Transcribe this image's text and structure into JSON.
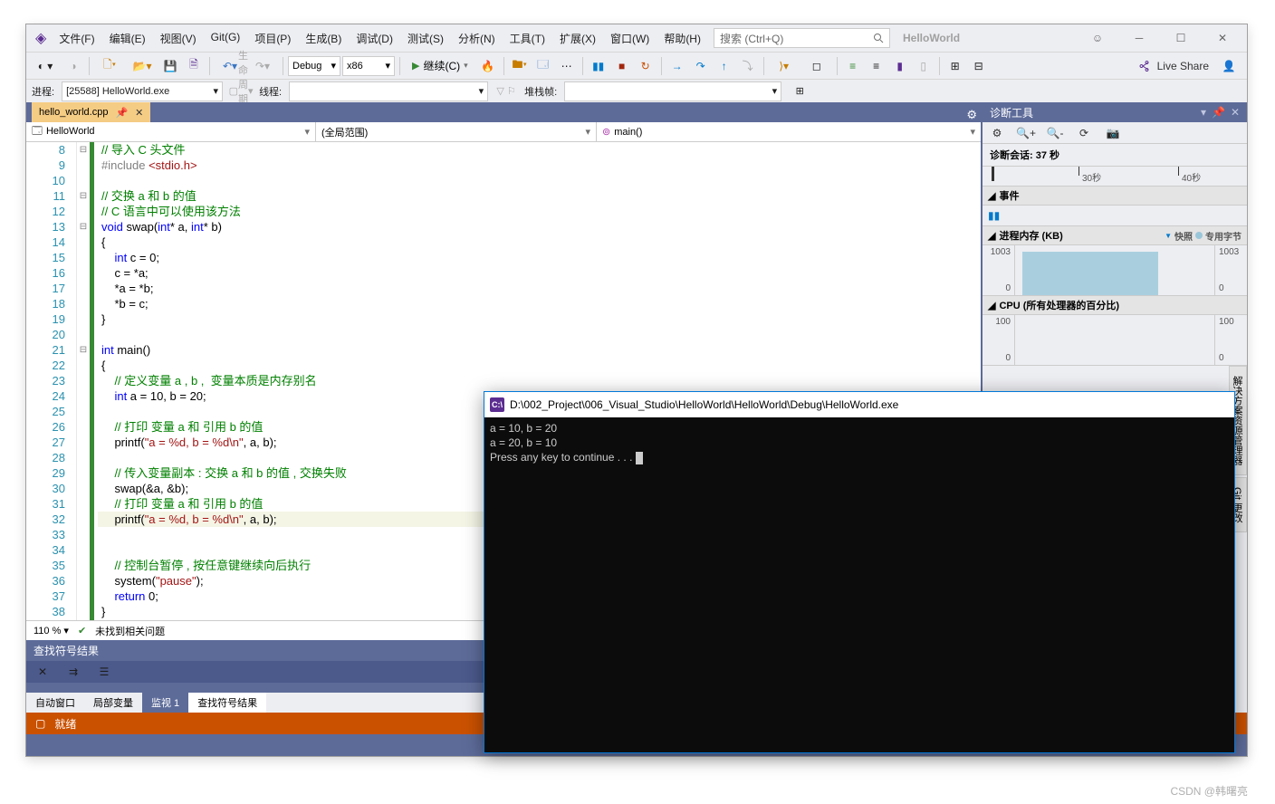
{
  "menu": {
    "file": "文件(F)",
    "edit": "编辑(E)",
    "view": "视图(V)",
    "git": "Git(G)",
    "project": "项目(P)",
    "build": "生成(B)",
    "debug": "调试(D)",
    "test": "测试(S)",
    "analyze": "分析(N)",
    "tools": "工具(T)",
    "ext": "扩展(X)",
    "window": "窗口(W)",
    "help": "帮助(H)"
  },
  "search_placeholder": "搜索 (Ctrl+Q)",
  "solution_name": "HelloWorld",
  "toolbar": {
    "config": "Debug",
    "platform": "x86",
    "continue": "继续(C)",
    "live_share": "Live Share"
  },
  "toolbar2": {
    "process_lbl": "进程:",
    "process_val": "[25588] HelloWorld.exe",
    "life_event": "生命周期事件",
    "thread_lbl": "线程:",
    "stack_lbl": "堆栈帧:"
  },
  "file_tab": "hello_world.cpp",
  "nav": {
    "project": "HelloWorld",
    "scope": "(全局范围)",
    "symbol": "main()"
  },
  "code_zoom": "110 %",
  "no_issues": "未找到相关问题",
  "code_lines": {
    "start": 8,
    "rows": [
      {
        "t": "cm",
        "s": "// 导入 C 头文件"
      },
      {
        "t": "inc",
        "s": "#include <stdio.h>"
      },
      {
        "t": "",
        "s": ""
      },
      {
        "t": "cm",
        "s": "// 交换 a 和 b 的值"
      },
      {
        "t": "cm",
        "s": "// C 语言中可以使用该方法"
      },
      {
        "t": "sig",
        "s": "void swap(int* a, int* b)"
      },
      {
        "t": "",
        "s": "{"
      },
      {
        "t": "stmt",
        "s": "    int c = 0;"
      },
      {
        "t": "",
        "s": "    c = *a;"
      },
      {
        "t": "",
        "s": "    *a = *b;"
      },
      {
        "t": "",
        "s": "    *b = c;"
      },
      {
        "t": "",
        "s": "}"
      },
      {
        "t": "",
        "s": ""
      },
      {
        "t": "sig2",
        "s": "int main()"
      },
      {
        "t": "",
        "s": "{"
      },
      {
        "t": "cm",
        "s": "    // 定义变量 a , b ,  变量本质是内存别名"
      },
      {
        "t": "decl",
        "s": "    int a = 10, b = 20;"
      },
      {
        "t": "",
        "s": ""
      },
      {
        "t": "cm",
        "s": "    // 打印 变量 a 和 引用 b 的值"
      },
      {
        "t": "pr",
        "s": "    printf(\"a = %d, b = %d\\n\", a, b);"
      },
      {
        "t": "",
        "s": ""
      },
      {
        "t": "cm",
        "s": "    // 传入变量副本 : 交换 a 和 b 的值 , 交换失败"
      },
      {
        "t": "",
        "s": "    swap(&a, &b);"
      },
      {
        "t": "cm",
        "s": "    // 打印 变量 a 和 引用 b 的值"
      },
      {
        "t": "pr",
        "s": "    printf(\"a = %d, b = %d\\n\", a, b);",
        "hl": true
      },
      {
        "t": "",
        "s": ""
      },
      {
        "t": "",
        "s": ""
      },
      {
        "t": "cm",
        "s": "    // 控制台暂停 , 按任意键继续向后执行"
      },
      {
        "t": "sys",
        "s": "    system(\"pause\");"
      },
      {
        "t": "ret",
        "s": "    return 0;"
      },
      {
        "t": "",
        "s": "}"
      }
    ]
  },
  "find_results": "查找符号结果",
  "bottom_tabs": {
    "auto": "自动窗口",
    "locals": "局部变量",
    "watch": "监视 1",
    "find": "查找符号结果"
  },
  "status_ready": "就绪",
  "diag": {
    "title": "诊断工具",
    "session": "诊断会话: 37 秒",
    "t30": "30秒",
    "t40": "40秒",
    "events": "事件",
    "mem_header": "进程内存 (KB)",
    "snapshot": "快照",
    "priv_bytes": "专用字节",
    "mem_max": "1003",
    "mem_min": "0",
    "cpu_header": "CPU (所有处理器的百分比)",
    "cpu_max": "100",
    "cpu_min": "0"
  },
  "side_tabs": {
    "sol": "解决方案资源管理器",
    "git": "Git 更改"
  },
  "console": {
    "title": "D:\\002_Project\\006_Visual_Studio\\HelloWorld\\HelloWorld\\Debug\\HelloWorld.exe",
    "l1": "a = 10, b = 20",
    "l2": "a = 20, b = 10",
    "l3": "Press any key to continue . . . "
  },
  "watermark": "CSDN @韩曙亮",
  "chart_data": [
    {
      "type": "area",
      "title": "进程内存 (KB)",
      "ylim": [
        0,
        1003
      ],
      "values_approx": [
        1003
      ],
      "series_name": "专用字节"
    },
    {
      "type": "line",
      "title": "CPU (所有处理器的百分比)",
      "ylim": [
        0,
        100
      ],
      "values_approx": [
        0
      ]
    }
  ]
}
